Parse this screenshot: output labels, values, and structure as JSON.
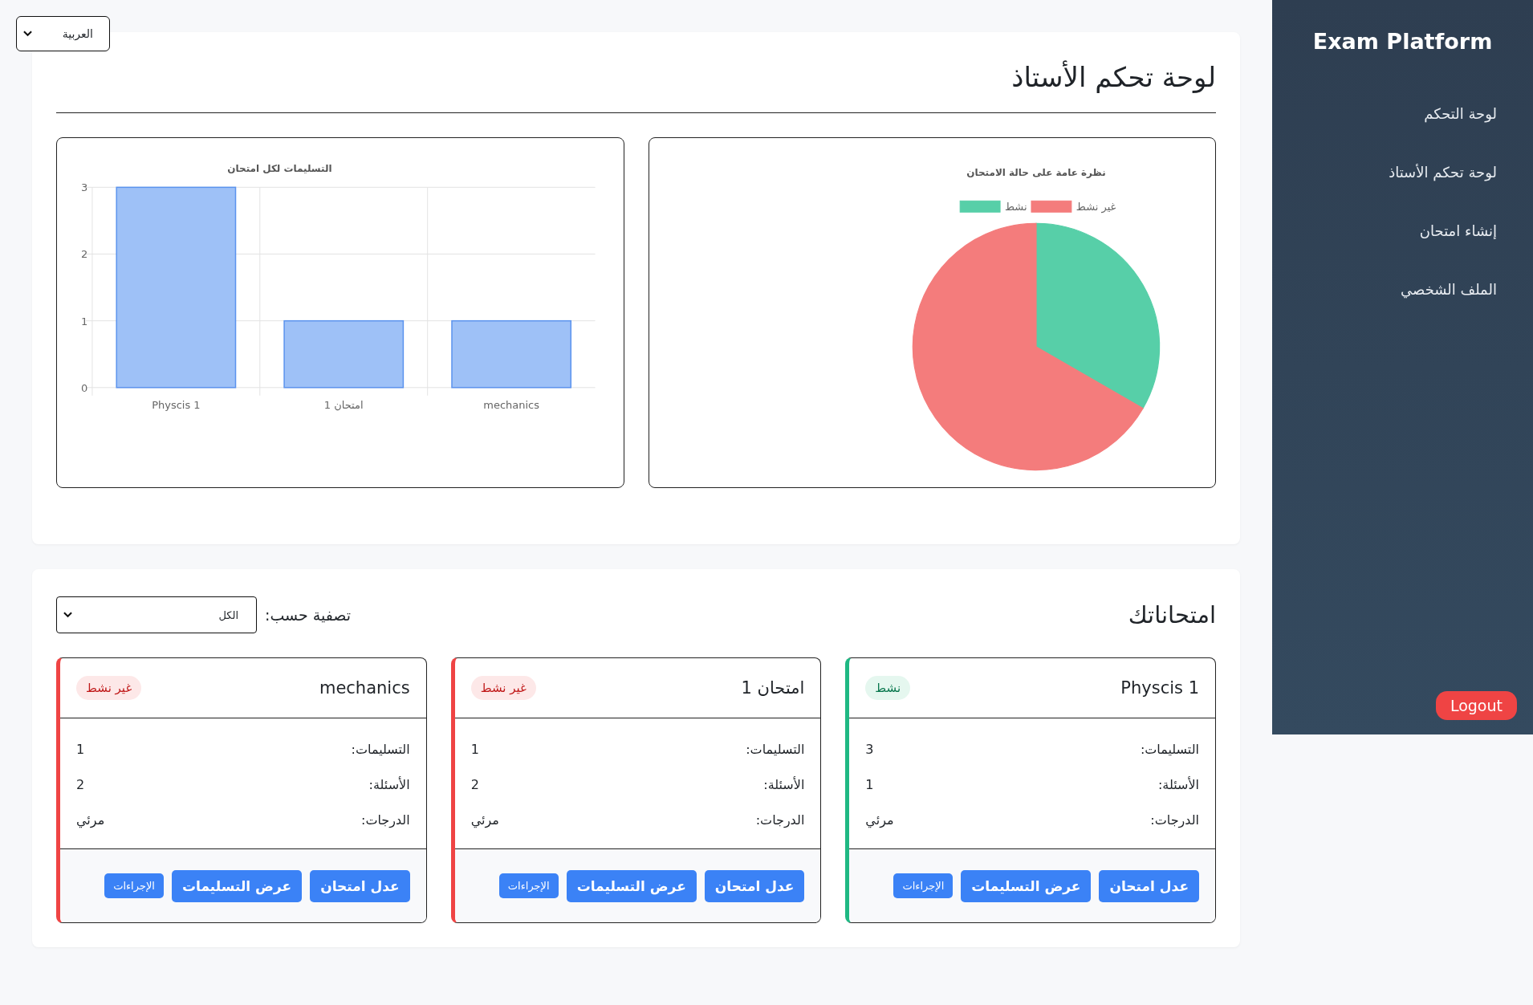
{
  "language_select": {
    "value": "العربية"
  },
  "dashboard": {
    "title": "لوحة تحكم الأستاذ",
    "charts": [
      {
        "chart_data": {
          "type": "pie",
          "title": "نظرة عامة على حالة الامتحان",
          "categories": [
            "نشط",
            "غير نشط"
          ],
          "values": [
            33.33,
            66.67
          ],
          "legend": "top",
          "colors": [
            "#57cfa8",
            "#f47c7c"
          ]
        }
      },
      {
        "chart_data": {
          "type": "bar",
          "title": "التسليمات لكل امتحان",
          "categories": [
            "Physcis 1",
            "امتحان 1",
            "mechanics"
          ],
          "values": [
            3,
            1,
            1
          ],
          "ylim": [
            0,
            3
          ],
          "yticks": [
            0,
            1,
            2,
            3
          ]
        }
      }
    ]
  },
  "exams": {
    "title": "امتحاناتك",
    "filter": {
      "label": "تصفية حسب:",
      "value": "الكل"
    },
    "items": [
      {
        "title": "Physcis 1",
        "active": true,
        "badge": "نشط",
        "stats": [
          {
            "label": "التسليمات:",
            "value": "3"
          },
          {
            "label": "الأسئلة:",
            "value": "1"
          },
          {
            "label": "الدرجات:",
            "value": "مرئي"
          }
        ],
        "buttons": [
          {
            "kind": "primary",
            "label": "عدل امتحان"
          },
          {
            "kind": "primary",
            "label": "عرض التسليمات"
          },
          {
            "kind": "small",
            "label": "الإجراءات"
          }
        ]
      },
      {
        "title": "امتحان 1",
        "active": false,
        "badge": "غير نشط",
        "stats": [
          {
            "label": "التسليمات:",
            "value": "1"
          },
          {
            "label": "الأسئلة:",
            "value": "2"
          },
          {
            "label": "الدرجات:",
            "value": "مرئي"
          }
        ],
        "buttons": [
          {
            "kind": "primary",
            "label": "عدل امتحان"
          },
          {
            "kind": "primary",
            "label": "عرض التسليمات"
          },
          {
            "kind": "small",
            "label": "الإجراءات"
          }
        ]
      },
      {
        "title": "mechanics",
        "active": false,
        "badge": "غير نشط",
        "stats": [
          {
            "label": "التسليمات:",
            "value": "1"
          },
          {
            "label": "الأسئلة:",
            "value": "2"
          },
          {
            "label": "الدرجات:",
            "value": "مرئي"
          }
        ],
        "buttons": [
          {
            "kind": "primary",
            "label": "عدل امتحان"
          },
          {
            "kind": "primary",
            "label": "عرض التسليمات"
          },
          {
            "kind": "small",
            "label": "الإجراءات"
          }
        ]
      }
    ]
  },
  "sidebar": {
    "title": "Exam Platform",
    "items": [
      "لوحة التحكم",
      "لوحة تحكم الأستاذ",
      "إنشاء امتحان",
      "الملف الشخصي"
    ],
    "logout": "Logout"
  }
}
